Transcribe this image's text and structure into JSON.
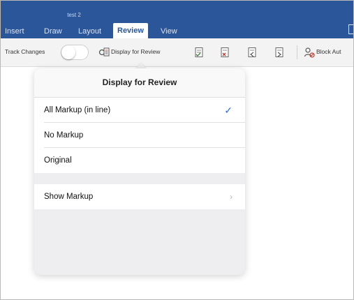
{
  "app": {
    "doc_title": "test 2",
    "tabs": [
      {
        "label": "Insert"
      },
      {
        "label": "Draw"
      },
      {
        "label": "Layout"
      },
      {
        "label": "Review",
        "active": true
      },
      {
        "label": "View"
      }
    ]
  },
  "ribbon": {
    "track_changes_label": "Track Changes",
    "track_changes_on": false,
    "display_for_review_label": "Display for Review",
    "block_authors_label": "Block Aut"
  },
  "popover": {
    "title": "Display for Review",
    "options": [
      {
        "label": "All Markup (in line)",
        "checked": true
      },
      {
        "label": "No Markup",
        "checked": false
      },
      {
        "label": "Original",
        "checked": false
      }
    ],
    "show_markup_label": "Show Markup",
    "check_glyph": "✓",
    "chevron_glyph": "›"
  },
  "colors": {
    "titlebar": "#2b579a",
    "accent_check": "#2e6fdb"
  }
}
